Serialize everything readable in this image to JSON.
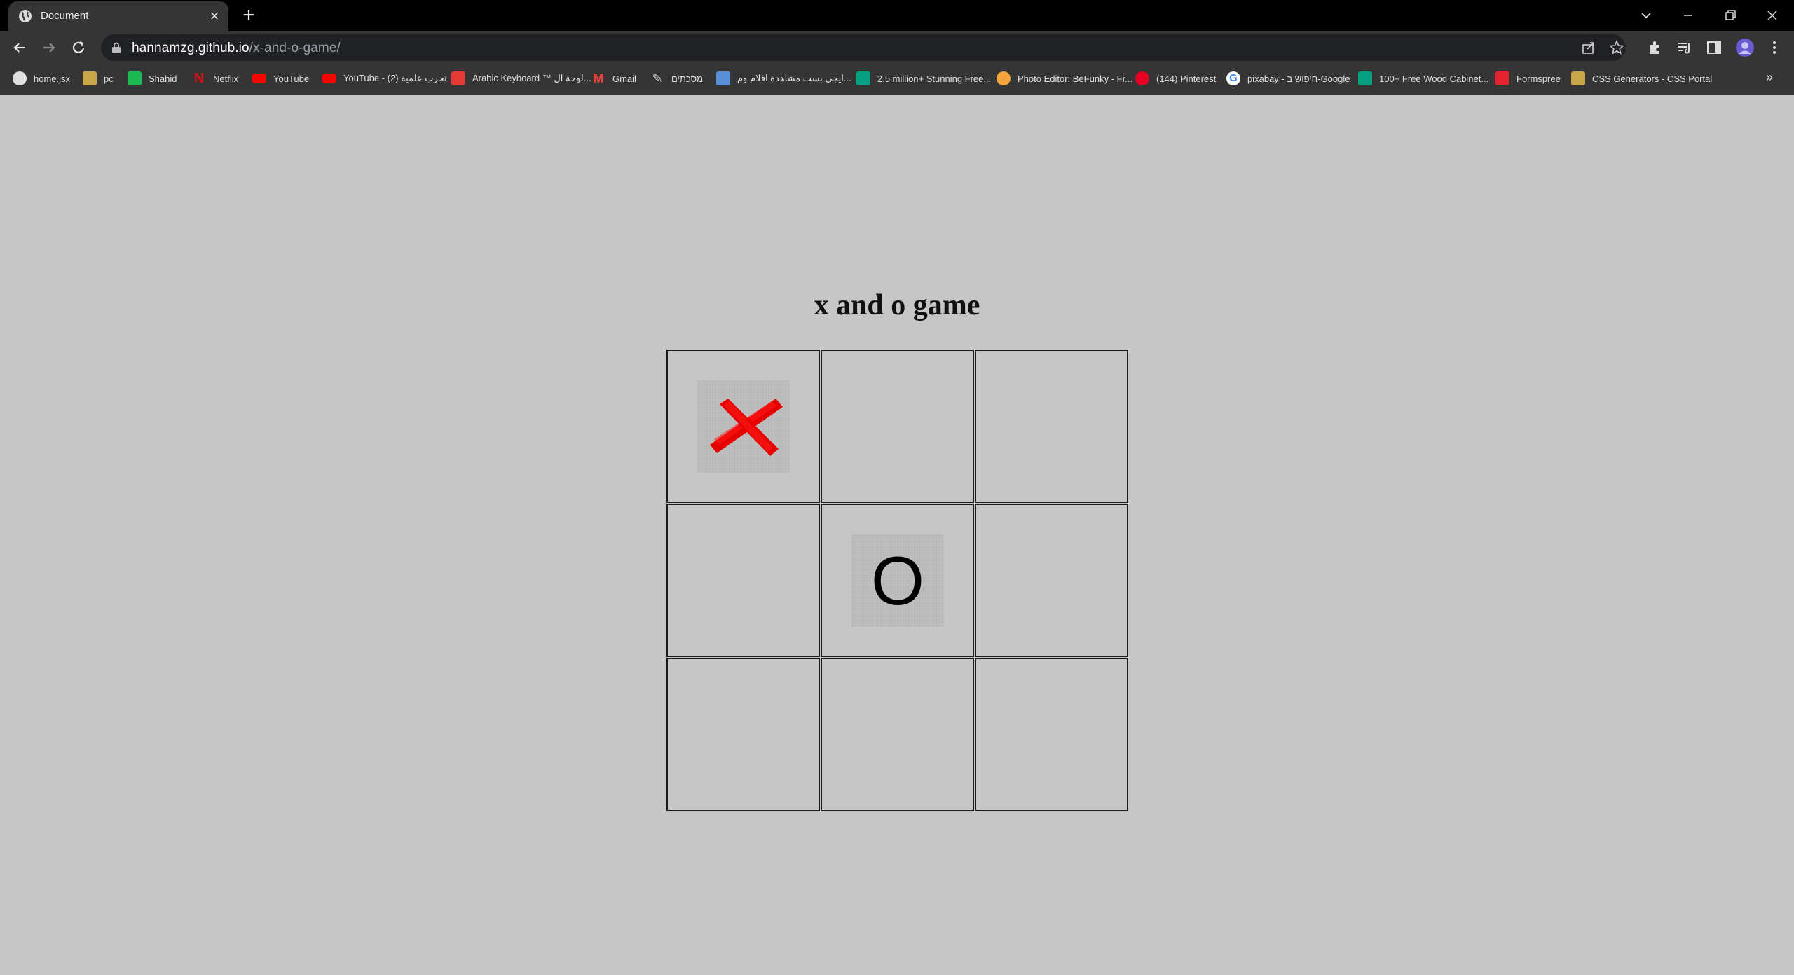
{
  "browser": {
    "tab_title": "Document",
    "url_host": "hannamzg.github.io",
    "url_path": "/x-and-o-game/"
  },
  "bookmarks": [
    {
      "label": "home.jsx",
      "icon": "globe-icon",
      "color": "#e0e0e0"
    },
    {
      "label": "pc",
      "icon": "folder-icon",
      "color": "#c9a64a"
    },
    {
      "label": "Shahid",
      "icon": "shahid-icon",
      "color": "#1db954"
    },
    {
      "label": "Netflix",
      "icon": "netflix-icon",
      "color": "#e50914"
    },
    {
      "label": "YouTube",
      "icon": "youtube-icon",
      "color": "#ff0000"
    },
    {
      "label": "YouTube - تجرب علمية (2)",
      "icon": "youtube-icon",
      "color": "#ff0000"
    },
    {
      "label": "Arabic Keyboard ™ لوحة ال...",
      "icon": "keyboard-icon",
      "color": "#e53935"
    },
    {
      "label": "Gmail",
      "icon": "gmail-icon",
      "color": "#ea4335"
    },
    {
      "label": "מסכתים",
      "icon": "pen-icon",
      "color": "#cfcfcf"
    },
    {
      "label": "ايجي بست مشاهدة افلام وم...",
      "icon": "egybest-icon",
      "color": "#5a8fd8"
    },
    {
      "label": "2.5 million+ Stunning Free...",
      "icon": "pexels-icon",
      "color": "#05a081"
    },
    {
      "label": "Photo Editor: BeFunky - Fr...",
      "icon": "befunky-icon",
      "color": "#f4a43a"
    },
    {
      "label": "(144) Pinterest",
      "icon": "pinterest-icon",
      "color": "#e60023"
    },
    {
      "label": "pixabay - חיפוש ב-Google",
      "icon": "google-icon",
      "color": "#4285f4"
    },
    {
      "label": "100+ Free Wood Cabinet...",
      "icon": "pexels-icon",
      "color": "#05a081"
    },
    {
      "label": "Formspree",
      "icon": "formspree-icon",
      "color": "#e5222e"
    },
    {
      "label": "CSS Generators - CSS Portal",
      "icon": "cssportal-icon",
      "color": "#c9a64a"
    }
  ],
  "page": {
    "title": "x and o game"
  },
  "board": {
    "cells": [
      "X",
      "",
      "",
      "",
      "O",
      "",
      "",
      "",
      ""
    ],
    "o_glyph": "O",
    "x_color": "#e60000"
  }
}
